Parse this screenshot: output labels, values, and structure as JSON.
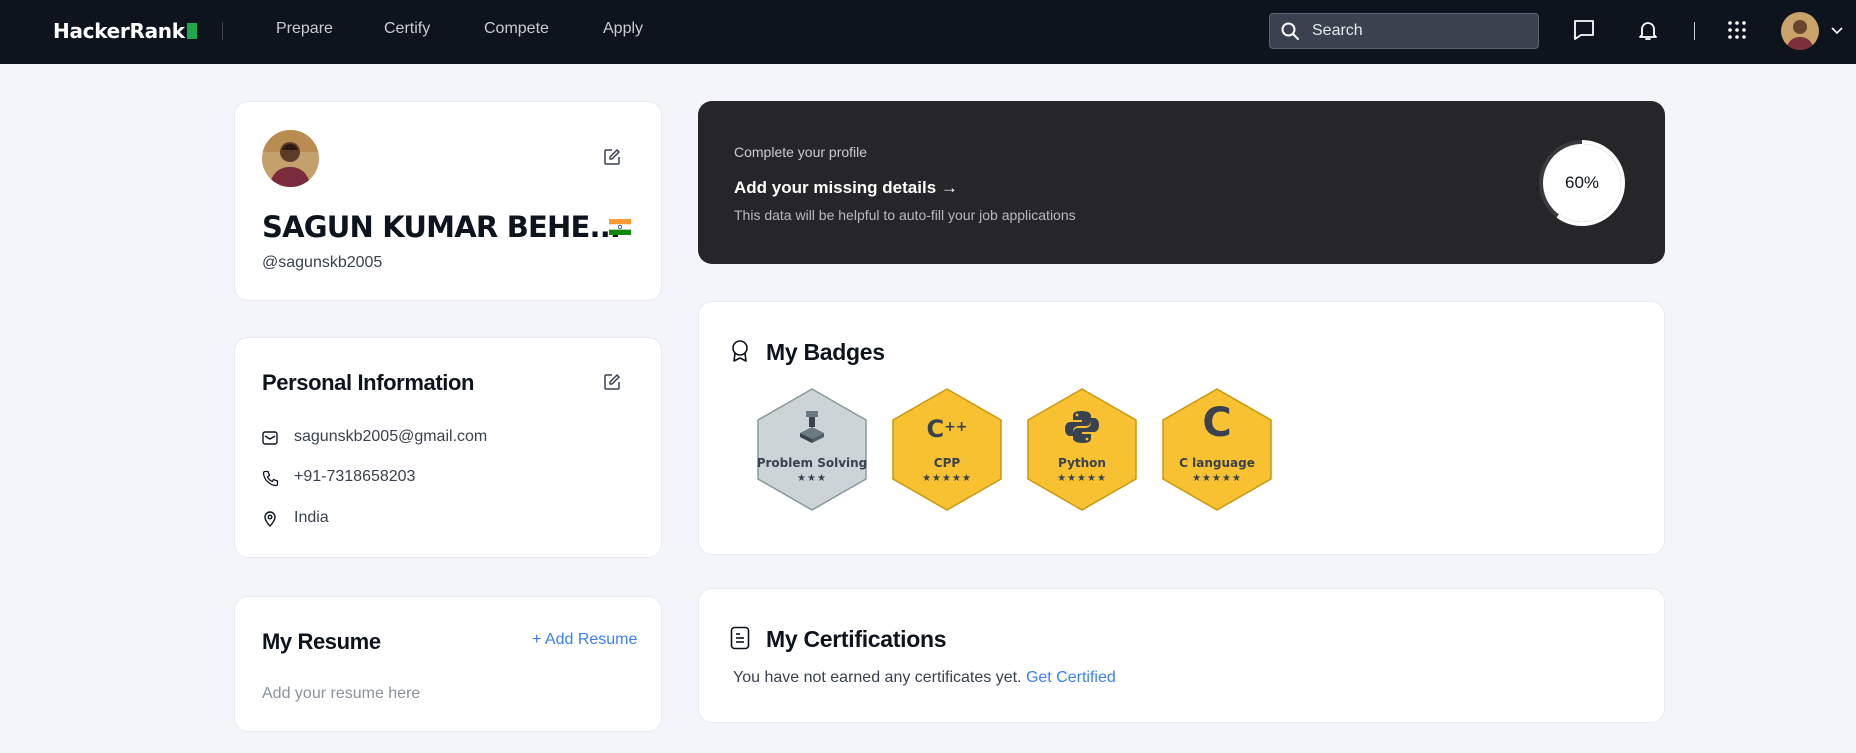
{
  "navbar": {
    "logo": "HackerRank",
    "links": [
      "Prepare",
      "Certify",
      "Compete",
      "Apply"
    ],
    "search_placeholder": "Search"
  },
  "profile": {
    "name": "SAGUN KUMAR BEHE...",
    "handle": "@sagunskb2005",
    "country_flag": "India"
  },
  "personal_info": {
    "title": "Personal Information",
    "email": "sagunskb2005@gmail.com",
    "phone": "+91-7318658203",
    "location": "India"
  },
  "resume": {
    "title": "My Resume",
    "add_label": "+ Add Resume",
    "hint": "Add your resume here"
  },
  "complete_profile": {
    "label": "Complete your profile",
    "title": "Add your missing details",
    "arrow": "→",
    "subtitle": "This data will be helpful to auto-fill your job applications",
    "progress_percent": 60,
    "progress_label": "60%"
  },
  "badges": {
    "title": "My Badges",
    "items": [
      {
        "name": "Problem Solving",
        "stars": 3,
        "star_text": "★★★",
        "tier": "silver"
      },
      {
        "name": "CPP",
        "stars": 5,
        "star_text": "★★★★★",
        "tier": "gold"
      },
      {
        "name": "Python",
        "stars": 5,
        "star_text": "★★★★★",
        "tier": "gold"
      },
      {
        "name": "C language",
        "stars": 5,
        "star_text": "★★★★★",
        "tier": "gold"
      }
    ]
  },
  "certifications": {
    "title": "My Certifications",
    "empty_text": "You have not earned any certificates yet.",
    "link_label": "Get Certified"
  },
  "colors": {
    "navbar_bg": "#0e141e",
    "accent_green": "#1ba94c",
    "link_blue": "#3a7ff6",
    "gold_badge": "#f7c131",
    "silver_badge": "#c8d2d6",
    "dark_card": "#262629"
  }
}
